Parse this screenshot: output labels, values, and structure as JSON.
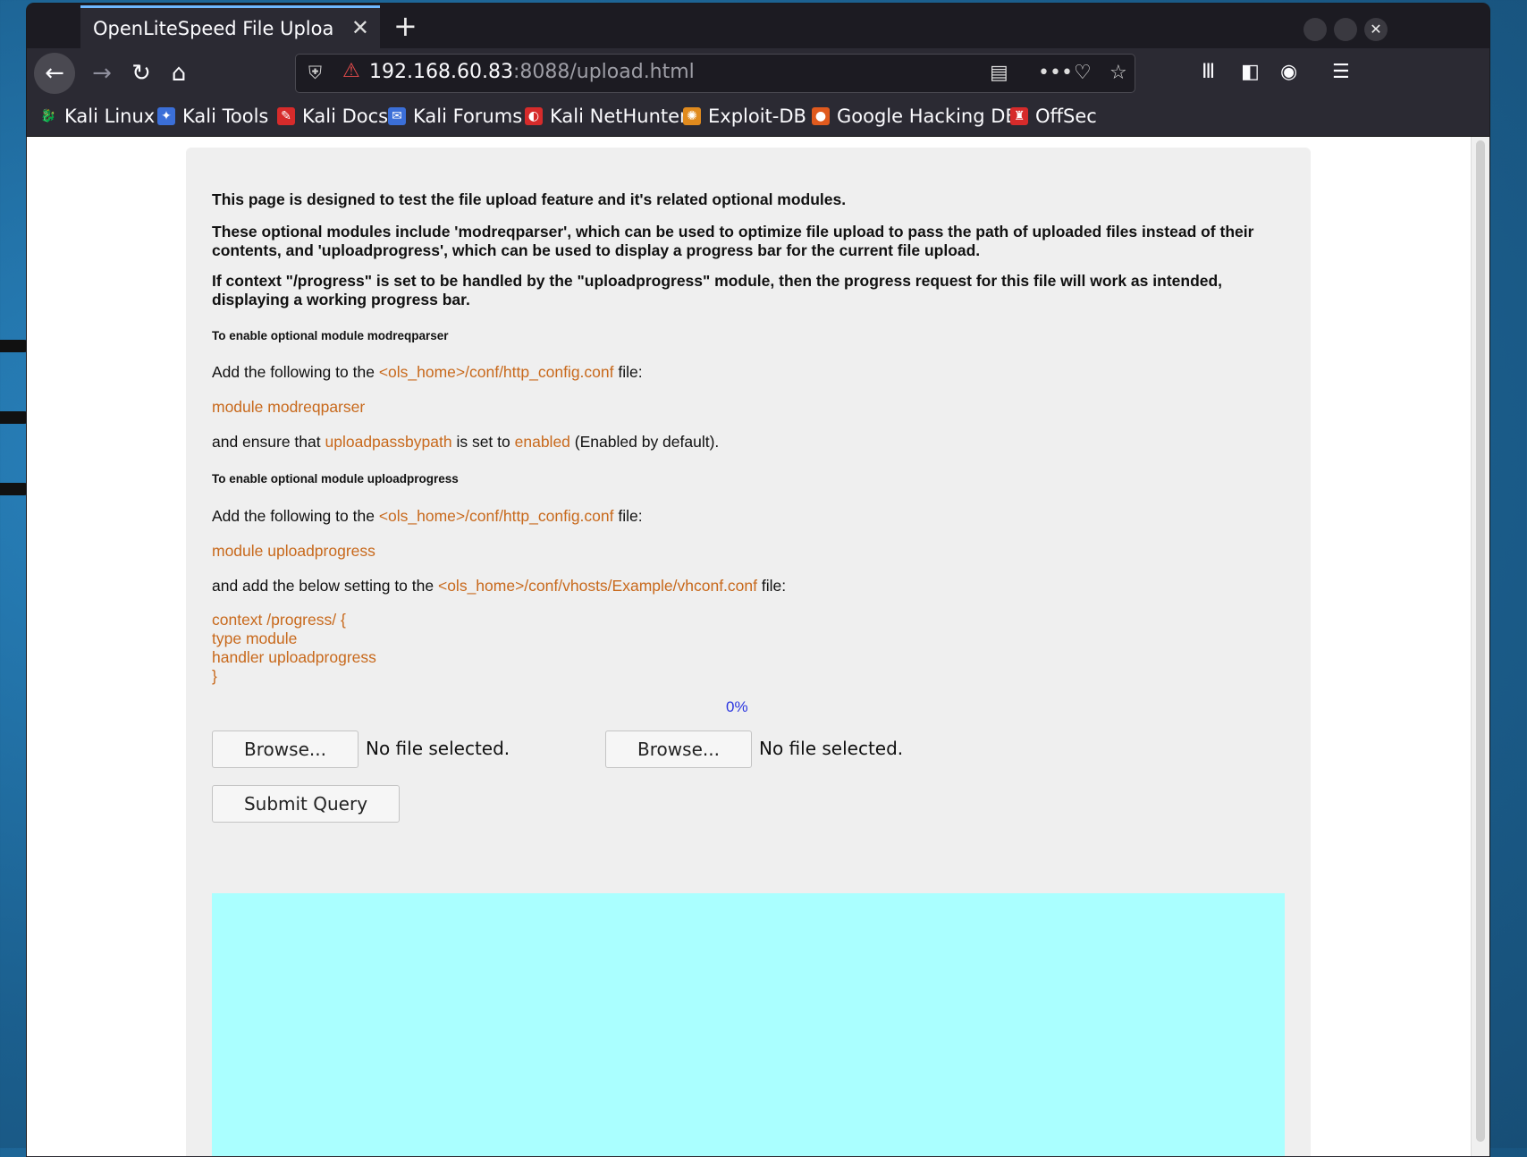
{
  "browser": {
    "tab_title": "OpenLiteSpeed File Upload",
    "tab_close": "✕",
    "new_tab": "+",
    "url_host": "192.168.60.83",
    "url_rest": ":8088/upload.html",
    "bookmarks": [
      {
        "label": "Kali Linux",
        "color": "#2b2a33"
      },
      {
        "label": "Kali Tools",
        "color": "#3b6fd8"
      },
      {
        "label": "Kali Docs",
        "color": "#d62b2b"
      },
      {
        "label": "Kali Forums",
        "color": "#3b6fd8"
      },
      {
        "label": "Kali NetHunter",
        "color": "#d62b2b"
      },
      {
        "label": "Exploit-DB",
        "color": "#e08a1e"
      },
      {
        "label": "Google Hacking DB",
        "color": "#e05a1e"
      },
      {
        "label": "OffSec",
        "color": "#d62b2b"
      }
    ]
  },
  "page": {
    "intro1": "This page is designed to test the file upload feature and it's related optional modules.",
    "intro2": "These optional modules include 'modreqparser', which can be used to optimize file upload to pass the path of uploaded files instead of their contents, and 'uploadprogress', which can be used to display a progress bar for the current file upload.",
    "intro3": "If context \"/progress\" is set to be handled by the \"uploadprogress\" module, then the progress request for this file will work as intended, displaying a working progress bar.",
    "h_modreq": "To enable optional module modreqparser",
    "add_following": "Add the following to the",
    "http_config": "<ols_home>/conf/http_config.conf",
    "file_word": "file:",
    "module_modreq": "module modreqparser",
    "ensure_prefix": "and ensure that",
    "uploadpassbypath": "uploadpassbypath",
    "is_set_to": "is set to",
    "enabled": "enabled",
    "enabled_default": "(Enabled by default).",
    "h_uploadprog": "To enable optional module uploadprogress",
    "module_uploadprog": "module uploadprogress",
    "add_below_prefix": "and add the below setting to the",
    "vhconf": "<ols_home>/conf/vhosts/Example/vhconf.conf",
    "context_block": "context /progress/ {\ntype module\nhandler uploadprogress\n}",
    "progress_pct": "0%",
    "browse_label": "Browse...",
    "no_file": "No file selected.",
    "submit_label": "Submit Query",
    "progress_color": "#aaffff"
  }
}
